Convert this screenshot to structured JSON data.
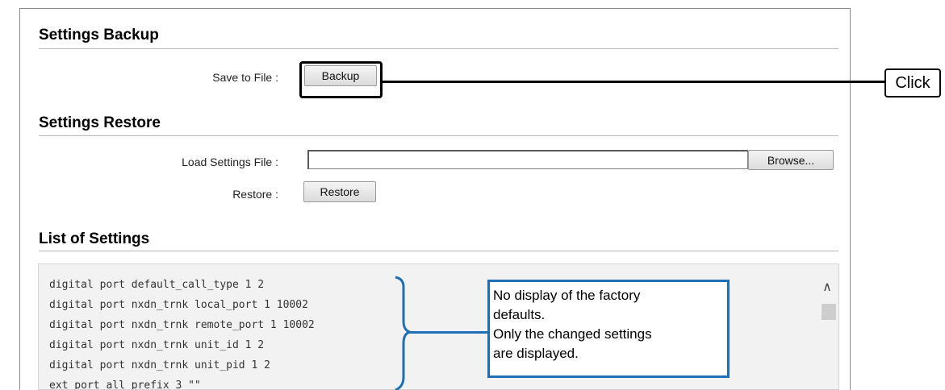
{
  "backup": {
    "title": "Settings Backup",
    "save_label": "Save to File :",
    "backup_button": "Backup"
  },
  "restore": {
    "title": "Settings Restore",
    "load_label": "Load Settings File :",
    "file_value": "",
    "browse_button": "Browse...",
    "restore_label": "Restore :",
    "restore_button": "Restore"
  },
  "list": {
    "title": "List of Settings",
    "lines": [
      "digital port default_call_type 1 2",
      "digital port nxdn_trnk local_port 1 10002",
      "digital port nxdn_trnk remote_port 1 10002",
      "digital port nxdn_trnk unit_id 1 2",
      "digital port nxdn_trnk unit_pid 1 2",
      "ext port all prefix 3 \"\""
    ],
    "scroll_up_icon": "chevron-up-icon"
  },
  "annotations": {
    "click_label": "Click",
    "note_lines": [
      "No display of the factory",
      "defaults.",
      "Only the changed settings",
      "are displayed."
    ],
    "note_color": "#1f6fb5"
  }
}
